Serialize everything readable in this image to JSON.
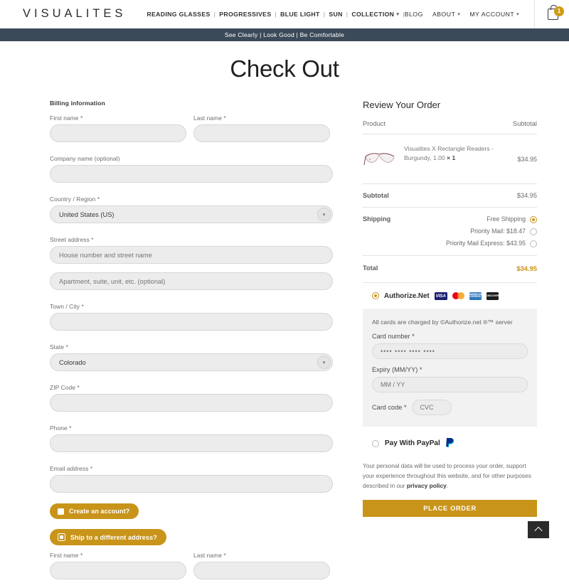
{
  "header": {
    "brand": "VISUALITES",
    "nav": [
      {
        "label": "READING GLASSES",
        "caret": false
      },
      {
        "label": "PROGRESSIVES",
        "caret": false
      },
      {
        "label": "BLUE LIGHT",
        "caret": false
      },
      {
        "label": "SUN",
        "caret": false
      },
      {
        "label": "COLLECTION",
        "caret": true
      }
    ],
    "separator": "|",
    "right_nav": [
      {
        "label": "BLOG",
        "caret": false
      },
      {
        "label": "ABOUT",
        "caret": true
      },
      {
        "label": "MY ACCOUNT",
        "caret": true
      }
    ],
    "cart_count": "1"
  },
  "announcement": "See Clearly | Look Good | Be Comfortable",
  "page_title": "Check Out",
  "billing": {
    "heading": "Billing information",
    "first_name_label": "First name *",
    "first_name_value": "",
    "last_name_label": "Last name *",
    "last_name_value": "",
    "company_label": "Company name (optional)",
    "company_value": "",
    "country_label": "Country / Region *",
    "country_value": "United States (US)",
    "street_label": "Street address *",
    "street_placeholder": "House number and street name",
    "street_line2_placeholder": "Apartment, suite, unit, etc. (optional)",
    "city_label": "Town / City *",
    "city_value": "",
    "state_label": "State *",
    "state_value": "Colorado",
    "zip_label": "ZIP Code *",
    "zip_value": "",
    "phone_label": "Phone *",
    "phone_value": "",
    "email_label": "Email address *",
    "email_value": "",
    "create_account_label": "Create an account?",
    "ship_different_label": "Ship to a different address?",
    "ship_first_name_label": "First name *",
    "ship_first_name_value": "",
    "ship_last_name_label": "Last name *",
    "ship_last_name_value": ""
  },
  "review": {
    "title": "Review Your Order",
    "col_product": "Product",
    "col_subtotal": "Subtotal",
    "item": {
      "name": "Visualites X Rectangle Readers - Burgundy, 1.00",
      "quantity": "× 1",
      "price": "$34.95"
    },
    "subtotal_label": "Subtotal",
    "subtotal_value": "$34.95",
    "shipping_label": "Shipping",
    "shipping_options": [
      {
        "label": "Free Shipping",
        "selected": true
      },
      {
        "label": "Priority Mail: $18.47",
        "selected": false
      },
      {
        "label": "Priority Mail Express: $43.95",
        "selected": false
      }
    ],
    "total_label": "Total",
    "total_value": "$34.95"
  },
  "payment": {
    "authorize_label": "Authorize.Net",
    "card_logos": [
      "VISA",
      "mastercard",
      "AMERICAN EXPRESS",
      "DISCOVER"
    ],
    "card_note": "All cards are charged by ©Authorize.net ®™ server",
    "card_number_label": "Card number *",
    "card_number_placeholder": "•••• •••• •••• ••••",
    "expiry_label": "Expiry (MM/YY) *",
    "expiry_placeholder": "MM / YY",
    "card_code_label": "Card code *",
    "card_code_placeholder": "CVC",
    "paypal_label": "Pay With PayPal",
    "privacy_text_1": "Your personal data will be used to process your order, support your experience throughout this website, and for other purposes described in our ",
    "privacy_link": "privacy policy",
    "privacy_text_2": ".",
    "place_order_label": "PLACE ORDER"
  },
  "colors": {
    "accent_gold": "#c8941a",
    "announce_bar": "#3b4a59",
    "field_fill": "#ececec"
  }
}
